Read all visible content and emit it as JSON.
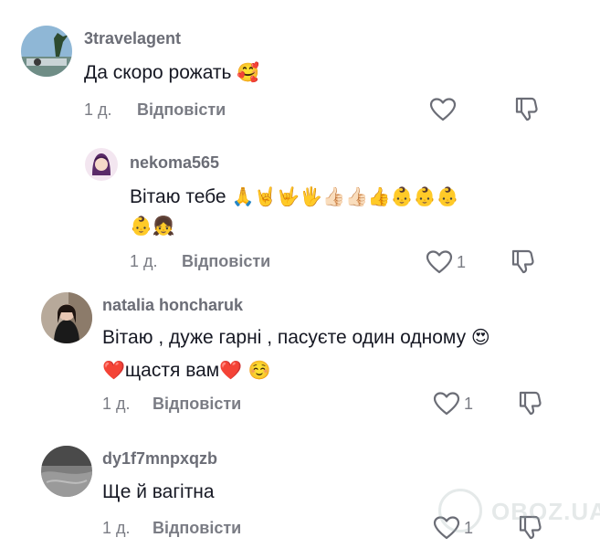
{
  "comments": [
    {
      "username": "3travelagent",
      "text": "Да скоро рожать",
      "emoji": "🥰",
      "time": "1 д.",
      "reply_label": "Відповісти",
      "like_count": ""
    },
    {
      "username": "nekoma565",
      "text": "Вітаю тебе",
      "emoji_line1": "🙏🤘🤟🖐👍🏻👍🏻👍👶👶👶",
      "emoji_line2": "👶👧",
      "time": "1 д.",
      "reply_label": "Відповісти",
      "like_count": "1"
    },
    {
      "username": "natalia honcharuk",
      "text": "Вітаю , дуже гарні , пасуєте один одному",
      "emoji_end": "😍",
      "line2_pre": "❤️",
      "line2_text": "щастя вам",
      "line2_post": "❤️ ☺️",
      "time": "1 д.",
      "reply_label": "Відповісти",
      "like_count": "1"
    },
    {
      "username": "dy1f7mnpxqzb",
      "text": "Ще й вагітна",
      "time": "1 д.",
      "reply_label": "Відповісти",
      "like_count": "1"
    }
  ],
  "watermark": "OBOZ.UA",
  "icons": [
    "heart-icon",
    "dislike-icon"
  ]
}
